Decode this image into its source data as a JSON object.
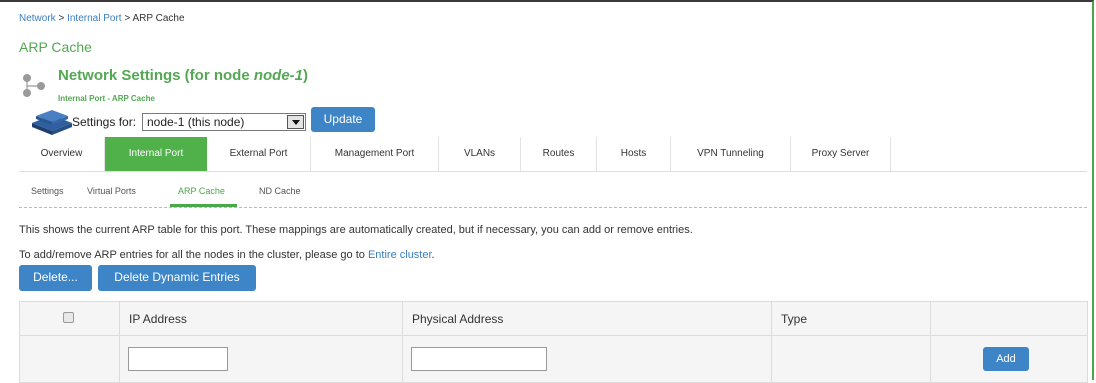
{
  "breadcrumb": {
    "items": [
      "Network",
      "Internal Port"
    ],
    "separator": ">",
    "current": "ARP Cache"
  },
  "page_title": "ARP Cache",
  "network_settings": {
    "title_prefix": "Network Settings (for node ",
    "node_name": "node-1",
    "title_suffix": ")",
    "subtitle": "Internal Port - ARP Cache"
  },
  "settings_for": {
    "label": "Settings for:",
    "selected": "node-1 (this node)",
    "update_label": "Update"
  },
  "tabs": [
    {
      "label": "Overview",
      "active": false
    },
    {
      "label": "Internal Port",
      "active": true
    },
    {
      "label": "External Port",
      "active": false
    },
    {
      "label": "Management Port",
      "active": false
    },
    {
      "label": "VLANs",
      "active": false
    },
    {
      "label": "Routes",
      "active": false
    },
    {
      "label": "Hosts",
      "active": false
    },
    {
      "label": "VPN Tunneling",
      "active": false
    },
    {
      "label": "Proxy Server",
      "active": false
    }
  ],
  "subtabs": [
    {
      "label": "Settings",
      "active": false
    },
    {
      "label": "Virtual Ports",
      "active": false
    },
    {
      "label": "ARP Cache",
      "active": true
    },
    {
      "label": "ND Cache",
      "active": false
    }
  ],
  "description": "This shows the current ARP table for this port. These mappings are automatically created, but if necessary, you can add or remove entries.",
  "cluster_note": {
    "text": "To add/remove ARP entries for all the nodes in the cluster, please go to ",
    "link": "Entire cluster",
    "end": "."
  },
  "actions": {
    "delete_label": "Delete...",
    "delete_dynamic_label": "Delete Dynamic Entries"
  },
  "table": {
    "columns": [
      "",
      "IP Address",
      "Physical Address",
      "Type",
      ""
    ],
    "new_row": {
      "ip_value": "",
      "mac_value": "",
      "add_label": "Add"
    }
  },
  "colors": {
    "accent_green": "#54a854",
    "button_blue": "#3d85c6",
    "link_blue": "#3a7ebf"
  }
}
